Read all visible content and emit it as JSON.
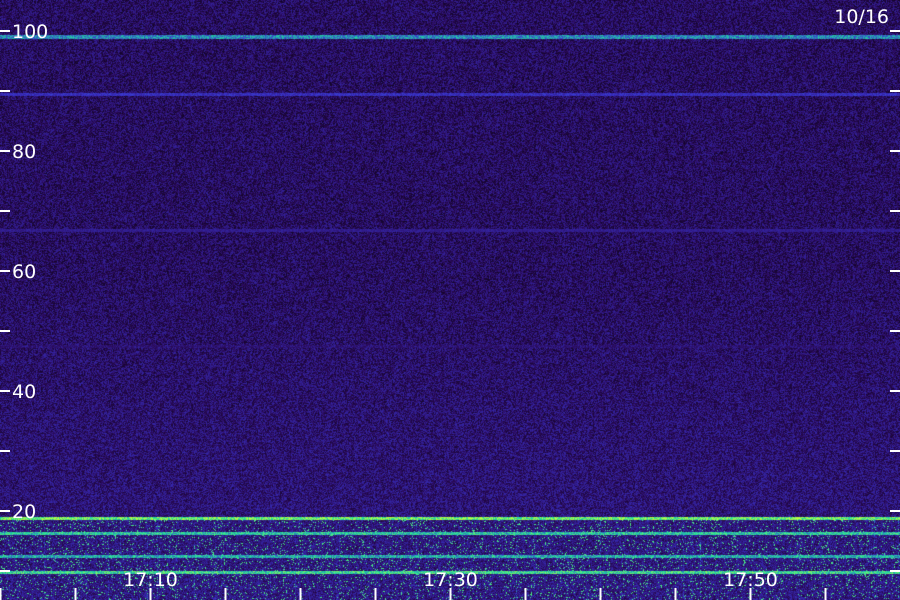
{
  "chart_data": {
    "type": "heatmap",
    "title": "",
    "date_label": "10/16",
    "xlabel": "",
    "ylabel": "",
    "y_tick_labels": [
      "100",
      "80",
      "60",
      "40",
      "20"
    ],
    "y_tick_values": [
      100,
      80,
      60,
      40,
      20
    ],
    "y_minor_tick_values": [
      90,
      70,
      50,
      30,
      10
    ],
    "ylim": [
      5,
      105
    ],
    "x_tick_labels": [
      "17:10",
      "17:30",
      "17:50"
    ],
    "x_tick_values_min": [
      10,
      30,
      50
    ],
    "x_minor_tick_values_min": [
      0,
      5,
      15,
      20,
      25,
      35,
      40,
      45,
      55
    ],
    "xlim_min": [
      0,
      60
    ],
    "grid": false,
    "legend": "none",
    "background_level": 0.35,
    "horizontal_lines": [
      {
        "y": 99.1,
        "intensity": 0.75
      },
      {
        "y": 89.5,
        "intensity": 0.55
      },
      {
        "y": 66.8,
        "intensity": 0.42
      },
      {
        "y": 47.5,
        "intensity": 0.3
      },
      {
        "y": 18.8,
        "intensity": 1.0
      },
      {
        "y": 16.3,
        "intensity": 0.85
      },
      {
        "y": 12.5,
        "intensity": 0.8
      },
      {
        "y": 9.8,
        "intensity": 0.9
      }
    ],
    "noisy_band": {
      "y_from": 5,
      "y_to": 18.5,
      "intensity": 0.8
    },
    "colors": {
      "background": "#000000",
      "low": "#2a0a5a",
      "mid": "#3a35d0",
      "high": "#20e0a0",
      "peak": "#c0ff40",
      "axis": "#ffffff"
    }
  }
}
